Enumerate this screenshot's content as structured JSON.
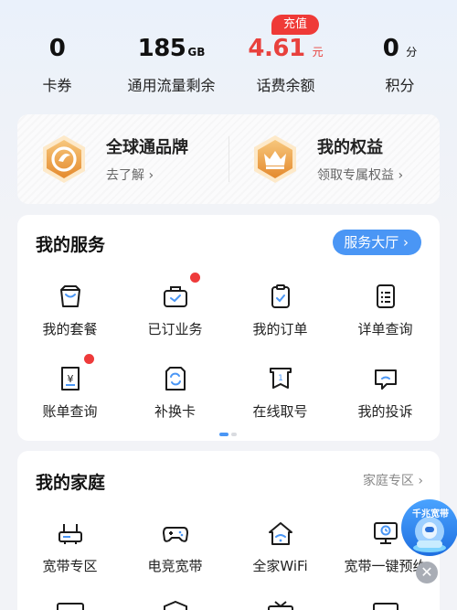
{
  "stats": [
    {
      "value": "0",
      "unit": "",
      "label": "卡券"
    },
    {
      "value": "185",
      "unit": "GB",
      "label": "通用流量剩余"
    },
    {
      "value": "4.61",
      "unit": "元",
      "label": "话费余额"
    },
    {
      "value": "0",
      "unit": "分",
      "label": "积分"
    }
  ],
  "recharge_badge": "充值",
  "banner": {
    "left": {
      "title": "全球通品牌",
      "subtitle": "去了解 ›"
    },
    "right": {
      "title": "我的权益",
      "subtitle": "领取专属权益 ›"
    }
  },
  "services": {
    "title": "我的服务",
    "hall_button": "服务大厅 ›",
    "items": [
      {
        "label": "我的套餐"
      },
      {
        "label": "已订业务"
      },
      {
        "label": "我的订单"
      },
      {
        "label": "详单查询"
      },
      {
        "label": "账单查询"
      },
      {
        "label": "补换卡"
      },
      {
        "label": "在线取号"
      },
      {
        "label": "我的投诉"
      }
    ]
  },
  "family": {
    "title": "我的家庭",
    "more_link": "家庭专区 ›",
    "items": [
      {
        "label": "宽带专区"
      },
      {
        "label": "电竞宽带"
      },
      {
        "label": "全家WiFi"
      },
      {
        "label": "宽带一键预约"
      }
    ]
  },
  "float_ad": {
    "text": "千兆宽带"
  },
  "colors": {
    "accent": "#4a96f5",
    "red": "#e8413d",
    "gold": "#f0a23c"
  }
}
